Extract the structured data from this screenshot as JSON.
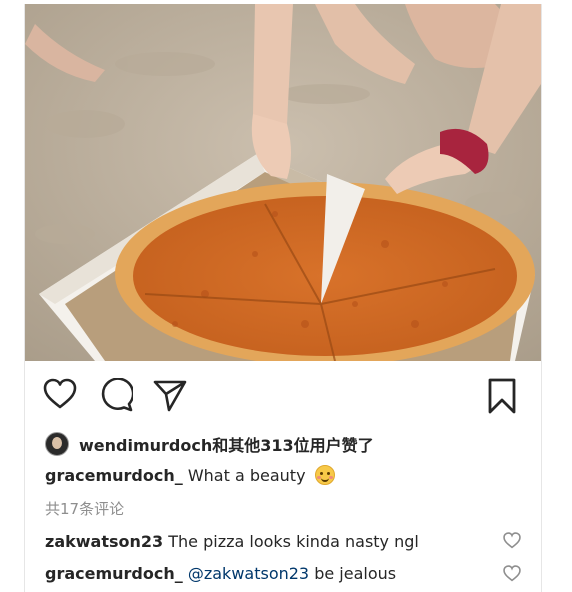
{
  "post": {
    "likes_text": "wendimurdoch和其他313位用户赞了",
    "caption_user": "gracemurdoch_",
    "caption_text": "What a beauty",
    "view_all_comments": "共17条评论",
    "comments": [
      {
        "user": "zakwatson23",
        "text": "The pizza looks kinda nasty ngl"
      },
      {
        "user": "gracemurdoch_",
        "mention": "@zakwatson23",
        "text": "be jealous"
      }
    ]
  },
  "icons": {
    "like": "heart-outline-icon",
    "comment": "comment-bubble-icon",
    "share": "paper-plane-icon",
    "save": "bookmark-icon",
    "emoji": "smiling-face-emoji"
  },
  "colors": {
    "text": "#262626",
    "muted": "#8e8e8e",
    "mention": "#00376b",
    "icon": "#262626"
  }
}
